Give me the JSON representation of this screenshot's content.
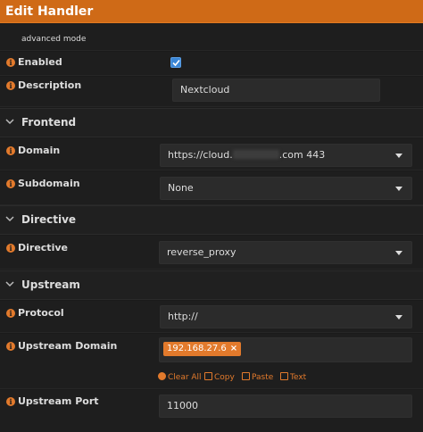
{
  "dialog": {
    "title": "Edit Handler"
  },
  "advanced_mode": {
    "label": "advanced mode"
  },
  "fields": {
    "enabled": {
      "label": "Enabled",
      "checked": true
    },
    "description": {
      "label": "Description",
      "value": "Nextcloud"
    },
    "domain": {
      "label": "Domain",
      "value_prefix": "https://cloud.",
      "value_suffix": ".com 443"
    },
    "subdomain": {
      "label": "Subdomain",
      "value": "None"
    },
    "directive": {
      "label": "Directive",
      "value": "reverse_proxy"
    },
    "protocol": {
      "label": "Protocol",
      "value": "http://"
    },
    "upstream_domain": {
      "label": "Upstream Domain",
      "tags": [
        "192.168.27.6"
      ]
    },
    "upstream_port": {
      "label": "Upstream Port",
      "value": "11000"
    }
  },
  "sections": {
    "frontend": "Frontend",
    "directive": "Directive",
    "upstream": "Upstream"
  },
  "tag_actions": {
    "clear_all": "Clear All",
    "copy": "Copy",
    "paste": "Paste",
    "text": "Text"
  },
  "colors": {
    "accent": "#cf6a17",
    "background": "#1b1b1b",
    "checkbox": "#3a86d6"
  }
}
